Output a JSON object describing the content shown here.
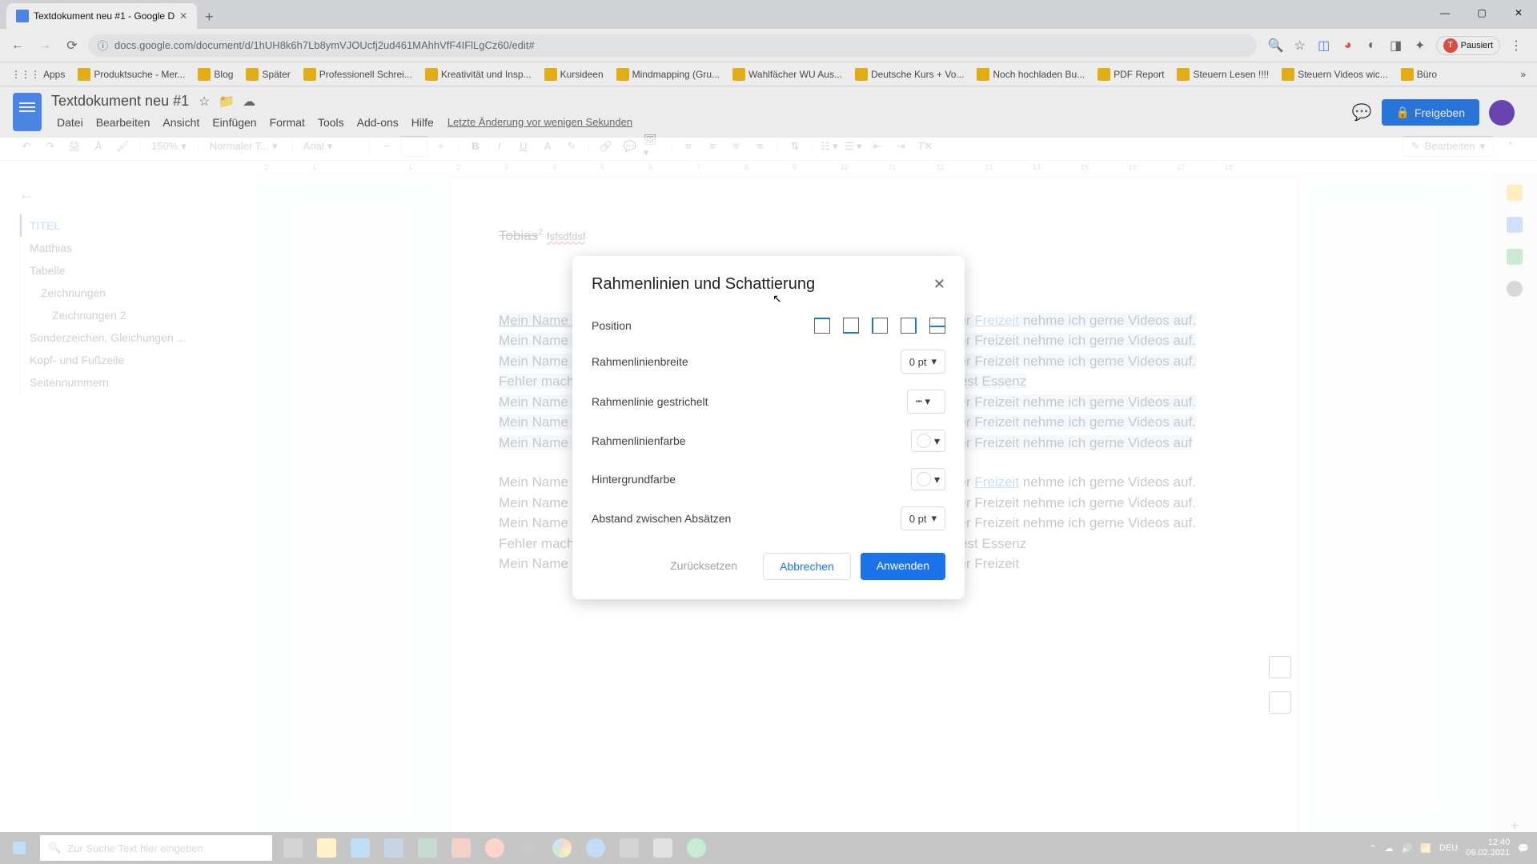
{
  "browser": {
    "tab_title": "Textdokument neu #1 - Google D",
    "url": "docs.google.com/document/d/1hUH8k6h7Lb8ymVJOUcfj2ud461MAhhVfF4IFlLgCz60/edit#",
    "pausiert_label": "Pausiert",
    "pausiert_initial": "T",
    "apps_label": "Apps",
    "bookmarks": [
      "Produktsuche - Mer...",
      "Blog",
      "Später",
      "Professionell Schrei...",
      "Kreativität und Insp...",
      "Kursideen",
      "Mindmapping  (Gru...",
      "Wahlfächer WU Aus...",
      "Deutsche Kurs + Vo...",
      "Noch hochladen Bu...",
      "PDF Report",
      "Steuern Lesen !!!!",
      "Steuern Videos wic...",
      "Büro"
    ]
  },
  "docs": {
    "title": "Textdokument neu #1",
    "menus": [
      "Datei",
      "Bearbeiten",
      "Ansicht",
      "Einfügen",
      "Format",
      "Tools",
      "Add-ons",
      "Hilfe"
    ],
    "last_change": "Letzte Änderung vor wenigen Sekunden",
    "share": "Freigeben",
    "zoom": "150%",
    "style": "Normaler T...",
    "font": "Arial",
    "edit": "Bearbeiten"
  },
  "ruler": [
    "2",
    "1",
    "",
    "1",
    "2",
    "3",
    "4",
    "5",
    "6",
    "7",
    "8",
    "9",
    "10",
    "11",
    "12",
    "13",
    "14",
    "15",
    "16",
    "17",
    "18"
  ],
  "outline": {
    "items": [
      {
        "label": "TITEL",
        "level": 0,
        "active": true
      },
      {
        "label": "Matthias",
        "level": 0
      },
      {
        "label": "Tabelle",
        "level": 0
      },
      {
        "label": "Zeichnungen",
        "level": 1
      },
      {
        "label": "Zeichnungen 2",
        "level": 2
      },
      {
        "label": "Sonderzeichen, Gleichungen ...",
        "level": 0
      },
      {
        "label": "Kopf- und Fußzeile",
        "level": 0
      },
      {
        "label": "Seitennummern",
        "level": 0
      }
    ]
  },
  "doc": {
    "tobias": "Tobias",
    "sup": "2",
    "fs": "fsfsdfdsf",
    "p1a": "Mein Name ist Matthias",
    "p1b": ". In meiner ",
    "freizeit": "Freizeit",
    "p2": " nehme ich gerne Videos auf. Mein Name ist Matthias. Ich bin Student in Wien. Ich bin ein Einsatz. In meiner Freizeit nehme ich gerne Videos auf. Mein Name ist Matthias. Ich bin Student in Wien. Ich bin ein Einsatz. In meiner Freizeit nehme ich gerne Videos auf. Fehler machen ist menschlich. Kein Problem für mich. Ich bin Österreicher. Test Essenz",
    "p3": "Mein Name ist Matthias. Ich bin Student in Wien. Ich bin ein Einsatz. In meiner Freizeit nehme ich gerne Videos auf. Mein Name ist Matthias. Ich bin Student in Wien. Ich bin ein Einsatz. In meiner Freizeit nehme ich gerne Videos auf. Mein Name ist Matthias. Ich bin Student in Wien. Ich bin ein Einsatz. In meiner Freizeit nehme ich gerne Videos auf",
    "p4a": "Mein Name ist Matthias. Ich bin Student in Wien. Ich bin ein Einsatz. In meiner ",
    "p4b": " nehme ich gerne Videos auf. Mein Name ist ",
    "matthias": "Matthias",
    "p4c": ". Ich bin Student in Wien. Ich bin ein Einsatz. In meiner Freizeit nehme ich gerne Videos auf. Mein Name ist Matthias. Ich bin Student in Wien. Ich bin ein Einsatz. In meiner Freizeit nehme ich gerne Videos auf. Fehler machen ist menschlich. Kein Problem für mich. Ich bin Österreicher. Test Essenz",
    "p5": "Mein Name ist Matthias. Ich bin Student in Wien. Ich bin ein Einsatz. In meiner Freizeit"
  },
  "dialog": {
    "title": "Rahmenlinien und Schattierung",
    "position": "Position",
    "width": "Rahmenlinienbreite",
    "dash": "Rahmenlinie gestrichelt",
    "color": "Rahmenlinienfarbe",
    "bg": "Hintergrundfarbe",
    "spacing": "Abstand zwischen Absätzen",
    "width_val": "0 pt",
    "spacing_val": "0 pt",
    "reset": "Zurücksetzen",
    "cancel": "Abbrechen",
    "apply": "Anwenden"
  },
  "taskbar": {
    "search_placeholder": "Zur Suche Text hier eingeben",
    "lang": "DEU",
    "time": "12:40",
    "date": "09.02.2021"
  }
}
